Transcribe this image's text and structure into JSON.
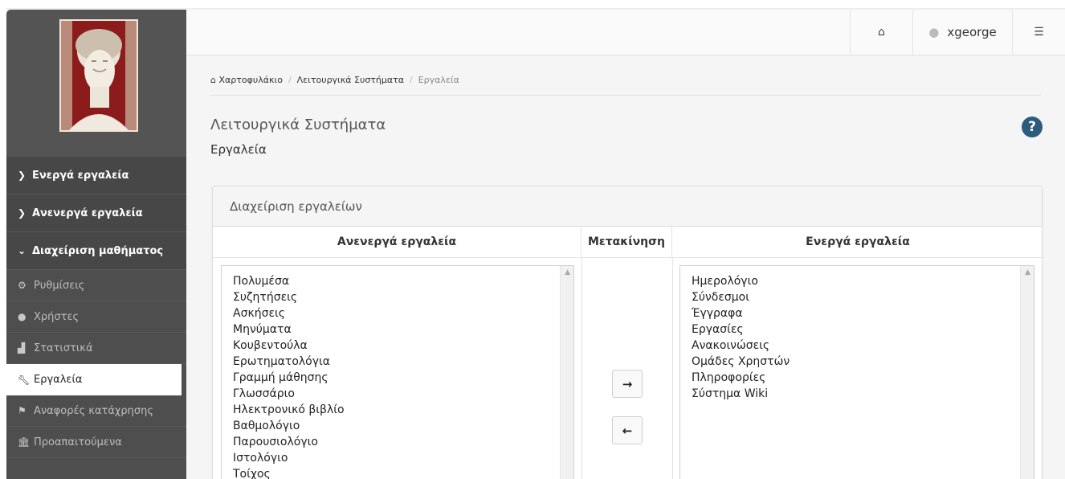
{
  "header": {
    "username": "xgeorge",
    "icons": {
      "home": "home-icon",
      "user": "user-icon",
      "settings": "sliders-icon"
    }
  },
  "sidebar": {
    "groups": [
      {
        "label": "Ενεργά εργαλεία",
        "icon": "chevron-right-icon"
      },
      {
        "label": "Ανενεργά εργαλεία",
        "icon": "chevron-right-icon"
      },
      {
        "label": "Διαχείριση μαθήματος",
        "icon": "chevron-down-icon"
      }
    ],
    "items": [
      {
        "label": "Ρυθμίσεις",
        "icon": "gears-icon"
      },
      {
        "label": "Χρήστες",
        "icon": "user-icon"
      },
      {
        "label": "Στατιστικά",
        "icon": "area-chart-icon"
      },
      {
        "label": "Εργαλεία",
        "icon": "wrench-icon",
        "active": true
      },
      {
        "label": "Αναφορές κατάχρησης",
        "icon": "flag-icon"
      },
      {
        "label": "Προαπαιτούμενα",
        "icon": "institution-icon"
      }
    ]
  },
  "breadcrumb": {
    "home": "Χαρτοφυλάκιο",
    "course": "Λειτουργικά Συστήματα",
    "current": "Εργαλεία"
  },
  "page": {
    "title": "Λειτουργικά Συστήματα",
    "subtitle": "Εργαλεία"
  },
  "panel": {
    "heading": "Διαχείριση εργαλείων",
    "columns": {
      "inactive": "Ανενεργά εργαλεία",
      "move": "Μετακίνηση",
      "active": "Ενεργά εργαλεία"
    },
    "inactive_tools": [
      "Πολυμέσα",
      "Συζητήσεις",
      "Ασκήσεις",
      "Μηνύματα",
      "Κουβεντούλα",
      "Ερωτηματολόγια",
      "Γραμμή μάθησης",
      "Γλωσσάριο",
      "Ηλεκτρονικό βιβλίο",
      "Βαθμολόγιο",
      "Παρουσιολόγιο",
      "Ιστολόγιο",
      "Τοίχος"
    ],
    "active_tools": [
      "Ημερολόγιο",
      "Σύνδεσμοι",
      "Έγγραφα",
      "Εργασίες",
      "Ανακοινώσεις",
      "Ομάδες Χρηστών",
      "Πληροφορίες",
      "Σύστημα Wiki"
    ]
  },
  "colors": {
    "sidebar_bg": "#4e4e4e",
    "help_icon": "#2c5b7e",
    "logo_red": "#8c1c1c"
  }
}
